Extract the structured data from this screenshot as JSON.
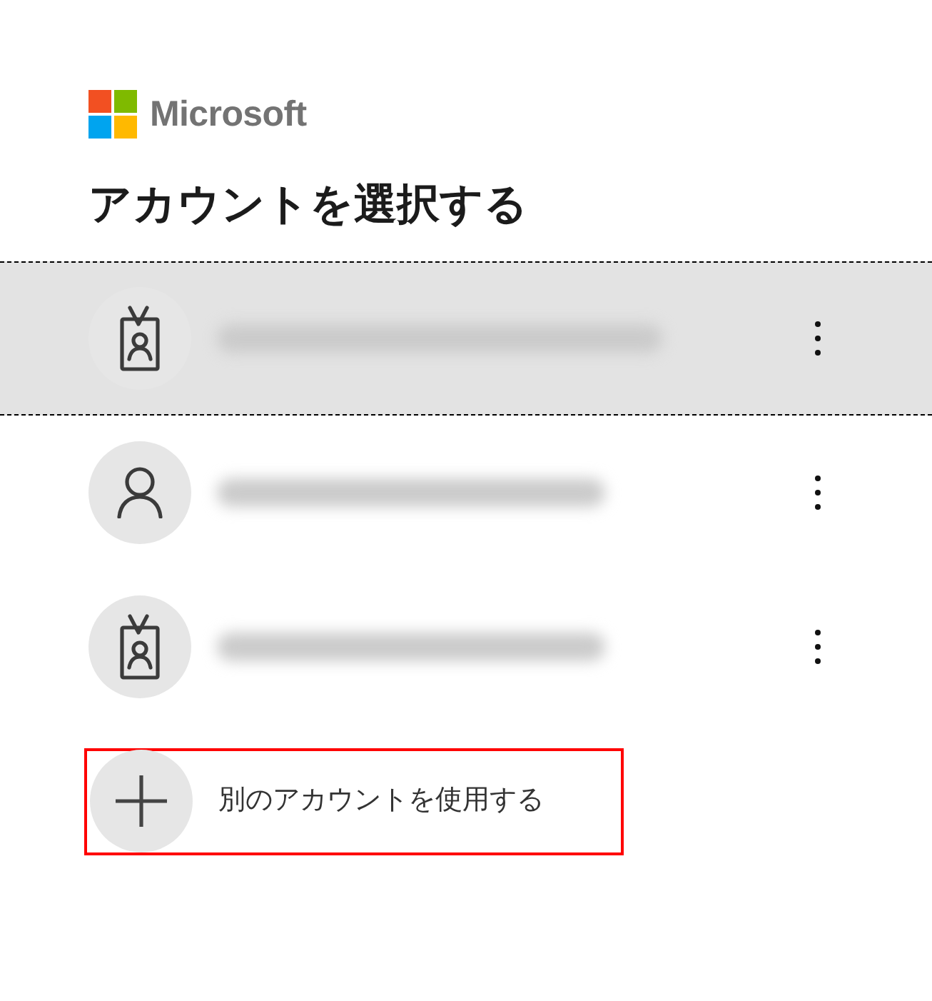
{
  "header": {
    "brand": "Microsoft",
    "title": "アカウントを選択する"
  },
  "accounts": [
    {
      "kind": "work",
      "selected": true
    },
    {
      "kind": "personal",
      "selected": false
    },
    {
      "kind": "work",
      "selected": false
    }
  ],
  "add_account": {
    "label": "別のアカウントを使用する",
    "highlighted": true
  }
}
